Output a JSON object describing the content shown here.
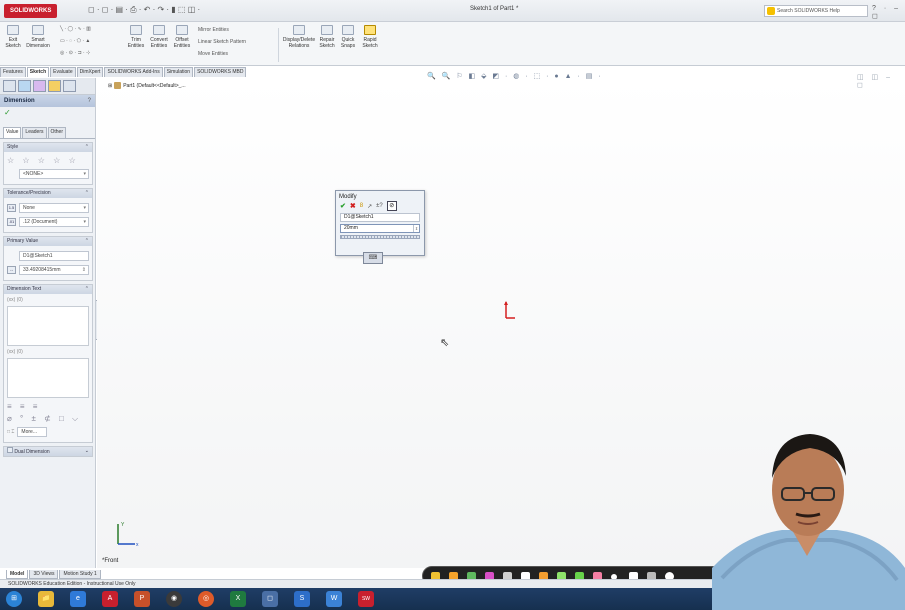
{
  "app": {
    "logo": "SOLIDWORKS",
    "doc_title": "Sketch1 of Part1 *",
    "help_search": "Search SOLIDWORKS Help",
    "quick_access": "◻ · ◻ · ▤ · ⎙ · ↶ · ↷ · ▮ ⬚ ◫ ·",
    "window_controls": "? · – ◻"
  },
  "ribbon": {
    "exit_sketch": "Exit Sketch",
    "smart_dimension": "Smart Dimension",
    "trim_entities": "Trim Entities",
    "convert_entities": "Convert Entities",
    "offset_entities": "Offset Entities",
    "mirror_entities": "Mirror Entities",
    "linear_pattern": "Linear Sketch Pattern",
    "move_entities": "Move Entities",
    "display_delete": "Display/Delete Relations",
    "repair_sketch": "Repair Sketch",
    "quick_snaps": "Quick Snaps",
    "rapid_sketch": "Rapid Sketch",
    "line_tools": "╲ · ◯ · ∿ · ▥",
    "rect_tools": "▭ · ◌ · ⬠ · ▲",
    "slot_tools": "◎ · ⊙ · ⊐ · ⊹"
  },
  "tabs": [
    "Features",
    "Sketch",
    "Evaluate",
    "DimXpert",
    "SOLIDWORKS Add-Ins",
    "Simulation",
    "SOLIDWORKS MBD"
  ],
  "property_manager": {
    "title": "Dimension",
    "help": "?",
    "ok_glyph": "✓",
    "subtabs": [
      "Value",
      "Leaders",
      "Other"
    ],
    "style": {
      "header": "Style",
      "icons": "☆ ☆ ☆ ☆ ☆",
      "value": "<NONE>"
    },
    "tolerance": {
      "header": "Tolerance/Precision",
      "type": "None",
      "precision": ".12 (Document)"
    },
    "primary": {
      "header": "Primary Value",
      "name": "D1@Sketch1",
      "value": "33.49208415mm"
    },
    "dim_text": {
      "header": "Dimension Text",
      "icons": "(xx) (0)",
      "icons2": "(xx) (0)",
      "align_icons": "≡ ≡ ≡",
      "symbols_icons": "⌀ ° ± ⊄ □ ⌵",
      "more_label": "More..."
    },
    "dual": {
      "header": "Dual Dimension"
    }
  },
  "tree": {
    "label": "Part1 (Default<<Default>_..."
  },
  "modify_dialog": {
    "title": "Modify",
    "name": "D1@Sketch1",
    "value": "20mm",
    "icons": {
      "ok": "✔",
      "cancel": "✖",
      "rebuild": "8",
      "reverse": "↗",
      "mark": "±?"
    }
  },
  "heads_up": "🔍 🔍 ⚐ ◧ ⬙ ◩ · ◍ · ⬚ · ● ▲ · ▤ ·",
  "viewport_ctrl": "◫ ◫ – ◻",
  "triad": {
    "x_label": "x",
    "y_label": "Y"
  },
  "view_label": "*Front",
  "bottom_tabs": [
    "Model",
    "3D Views",
    "Motion Study 1"
  ],
  "status": "SOLIDWORKS Education Edition - Instructional Use Only",
  "taskbar": {
    "start": "⊞",
    "items": [
      "📁",
      "e",
      "A",
      "P",
      "◉",
      "◎",
      "X",
      "◻",
      "S",
      "W",
      "SW"
    ]
  }
}
